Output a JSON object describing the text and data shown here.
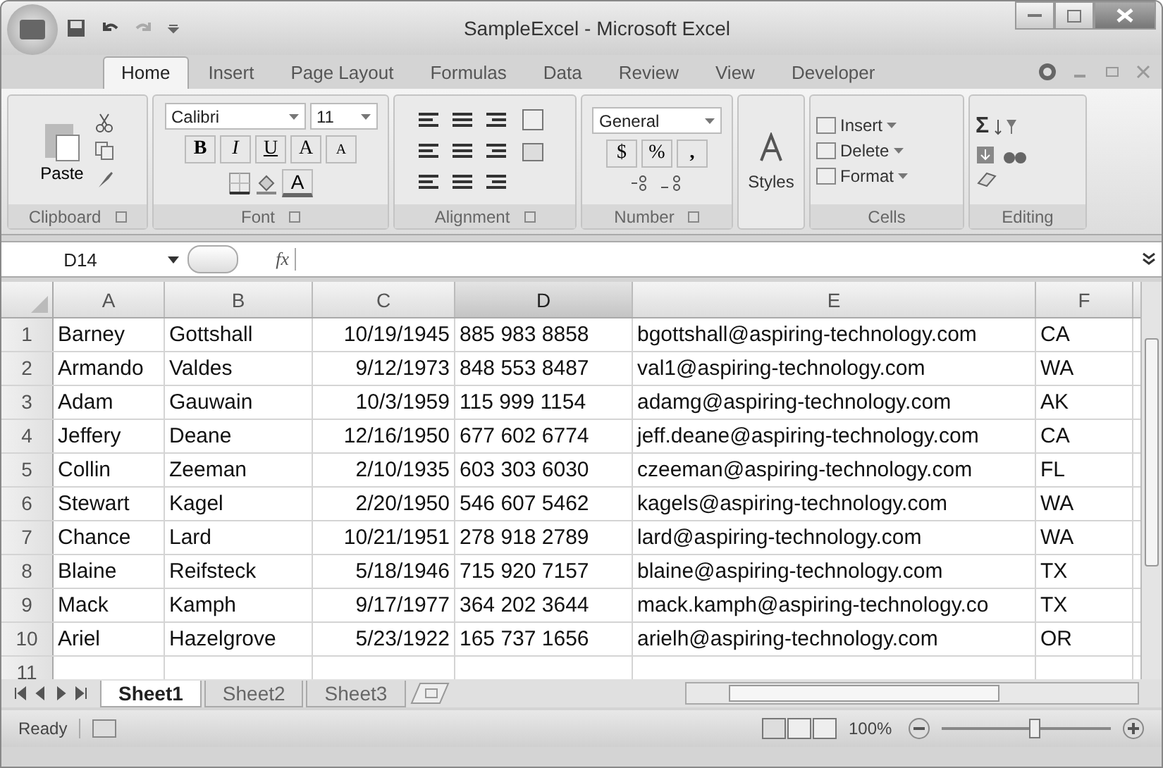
{
  "window": {
    "title": "SampleExcel - Microsoft Excel"
  },
  "tabs": [
    {
      "label": "Home",
      "selected": true
    },
    {
      "label": "Insert",
      "selected": false
    },
    {
      "label": "Page Layout",
      "selected": false
    },
    {
      "label": "Formulas",
      "selected": false
    },
    {
      "label": "Data",
      "selected": false
    },
    {
      "label": "Review",
      "selected": false
    },
    {
      "label": "View",
      "selected": false
    },
    {
      "label": "Developer",
      "selected": false
    }
  ],
  "ribbon": {
    "clipboard": {
      "label": "Clipboard",
      "paste": "Paste"
    },
    "font": {
      "label": "Font",
      "family": "Calibri",
      "size": "11",
      "bold": "B",
      "italic": "I",
      "underline": "U",
      "grow": "A",
      "shrink": "A",
      "text_color": "A"
    },
    "alignment": {
      "label": "Alignment"
    },
    "number": {
      "label": "Number",
      "format": "General",
      "currency": "$",
      "percent": "%",
      "comma": ","
    },
    "styles": {
      "label": "Styles"
    },
    "cells": {
      "label": "Cells",
      "items": [
        "Insert",
        "Delete",
        "Format"
      ]
    },
    "editing": {
      "label": "Editing",
      "sum": "Σ"
    }
  },
  "formula_bar": {
    "name_box": "D14",
    "fx": "fx"
  },
  "table": {
    "columns": [
      {
        "label": "A",
        "selected": false
      },
      {
        "label": "B",
        "selected": false
      },
      {
        "label": "C",
        "selected": false
      },
      {
        "label": "D",
        "selected": true
      },
      {
        "label": "E",
        "selected": false
      },
      {
        "label": "F",
        "selected": false
      }
    ],
    "rows": [
      {
        "number": "1",
        "cells": [
          "Barney",
          "Gottshall",
          "10/19/1945",
          "885 983 8858",
          "bgottshall@aspiring-technology.com",
          "CA"
        ]
      },
      {
        "number": "2",
        "cells": [
          "Armando",
          "Valdes",
          "9/12/1973",
          "848 553 8487",
          "val1@aspiring-technology.com",
          "WA"
        ]
      },
      {
        "number": "3",
        "cells": [
          "Adam",
          "Gauwain",
          "10/3/1959",
          "115 999 1154",
          "adamg@aspiring-technology.com",
          "AK"
        ]
      },
      {
        "number": "4",
        "cells": [
          "Jeffery",
          "Deane",
          "12/16/1950",
          "677 602 6774",
          "jeff.deane@aspiring-technology.com",
          "CA"
        ]
      },
      {
        "number": "5",
        "cells": [
          "Collin",
          "Zeeman",
          "2/10/1935",
          "603 303 6030",
          "czeeman@aspiring-technology.com",
          "FL"
        ]
      },
      {
        "number": "6",
        "cells": [
          "Stewart",
          "Kagel",
          "2/20/1950",
          "546 607 5462",
          "kagels@aspiring-technology.com",
          "WA"
        ]
      },
      {
        "number": "7",
        "cells": [
          "Chance",
          "Lard",
          "10/21/1951",
          "278 918 2789",
          "lard@aspiring-technology.com",
          "WA"
        ]
      },
      {
        "number": "8",
        "cells": [
          "Blaine",
          "Reifsteck",
          "5/18/1946",
          "715 920 7157",
          "blaine@aspiring-technology.com",
          "TX"
        ]
      },
      {
        "number": "9",
        "cells": [
          "Mack",
          "Kamph",
          "9/17/1977",
          "364 202 3644",
          "mack.kamph@aspiring-technology.co",
          "TX"
        ]
      },
      {
        "number": "10",
        "cells": [
          "Ariel",
          "Hazelgrove",
          "5/23/1922",
          "165 737 1656",
          "arielh@aspiring-technology.com",
          "OR"
        ]
      },
      {
        "number": "11"
      }
    ]
  },
  "sheet_tabs": [
    {
      "label": "Sheet1",
      "selected": true
    },
    {
      "label": "Sheet2",
      "selected": false
    },
    {
      "label": "Sheet3",
      "selected": false
    }
  ],
  "status_bar": {
    "text": "Ready",
    "zoom": "100%",
    "level": 0.55
  }
}
